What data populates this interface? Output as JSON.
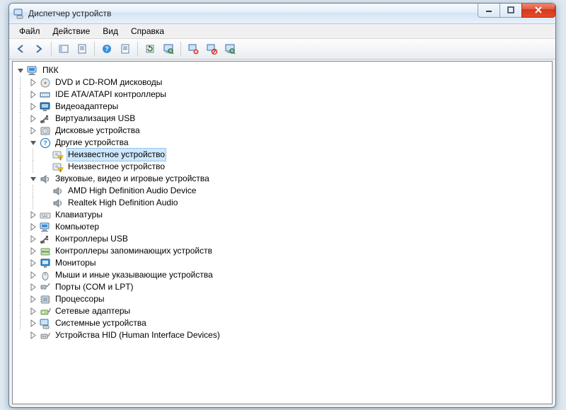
{
  "window": {
    "title": "Диспетчер устройств"
  },
  "menu": {
    "file": "Файл",
    "action": "Действие",
    "view": "Вид",
    "help": "Справка"
  },
  "tree": {
    "root": "ПКК",
    "dvd": "DVD и CD-ROM дисководы",
    "ide": "IDE ATA/ATAPI контроллеры",
    "video": "Видеоадаптеры",
    "usb_virt": "Виртуализация USB",
    "disk": "Дисковые устройства",
    "other": "Другие устройства",
    "unknown1": "Неизвестное устройство",
    "unknown2": "Неизвестное устройство",
    "sound": "Звуковые, видео и игровые устройства",
    "sound1": "AMD High Definition Audio Device",
    "sound2": "Realtek High Definition Audio",
    "keyboard": "Клавиатуры",
    "computer": "Компьютер",
    "usb": "Контроллеры USB",
    "storage": "Контроллеры запоминающих устройств",
    "monitor": "Мониторы",
    "mouse": "Мыши и иные указывающие устройства",
    "ports": "Порты (COM и LPT)",
    "cpu": "Процессоры",
    "network": "Сетевые адаптеры",
    "system": "Системные устройства",
    "hid": "Устройства HID (Human Interface Devices)"
  }
}
